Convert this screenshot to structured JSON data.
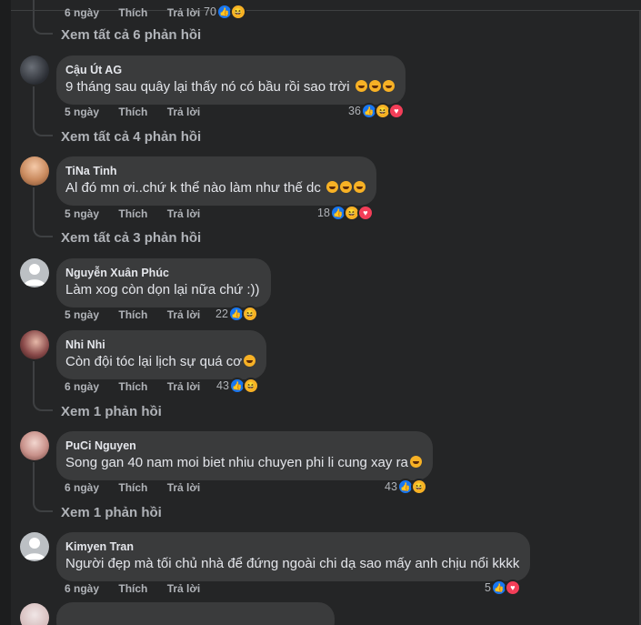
{
  "top_partial": {
    "time": "6 ngày",
    "like": "Thích",
    "reply": "Trả lời",
    "count": "70"
  },
  "view_all_1": "Xem tất cả 6 phản hồi",
  "comments": [
    {
      "author": "Cậu Út AG",
      "text": "9 tháng sau quây lại thấy nó có bầu rồi sao trời",
      "emojis": "rofl-icon x3",
      "time": "5 ngày",
      "like": "Thích",
      "reply": "Trả lời",
      "count": "36",
      "more": "Xem tất cả 4 phản hồi"
    },
    {
      "author": "TiNa Tinh",
      "text": "Al đó mn ơi..chứ k thể nào làm như thế dc",
      "emojis": "rofl-icon x3",
      "time": "5 ngày",
      "like": "Thích",
      "reply": "Trả lời",
      "count": "18",
      "more": "Xem tất cả 3 phản hồi"
    },
    {
      "author": "Nguyễn Xuân Phúc",
      "text": "Làm xog còn dọn lại nữa chứ :))",
      "time": "5 ngày",
      "like": "Thích",
      "reply": "Trả lời",
      "count": "22"
    },
    {
      "author": "Nhi Nhi",
      "text": "Còn đội tóc lại lịch sự quá cơ",
      "emojis": "relieved-icon",
      "time": "6 ngày",
      "like": "Thích",
      "reply": "Trả lời",
      "count": "43",
      "more": "Xem 1 phản hồi"
    },
    {
      "author": "PuCi Nguyen",
      "text": "Song gan 40 nam moi biet nhiu chuyen phi li cung xay ra",
      "emojis": "thinking-icon",
      "time": "6 ngày",
      "like": "Thích",
      "reply": "Trả lời",
      "count": "43",
      "more": "Xem 1 phản hồi"
    },
    {
      "author": "Kimyen Tran",
      "text": "Người đẹp mà tối chủ nhà để đứng ngoài chi dạ sao mấy anh chịu nổi kkkk",
      "time": "6 ngày",
      "like": "Thích",
      "reply": "Trả lời",
      "count": "5"
    }
  ],
  "colors": {
    "background": "#242526",
    "bubble": "#3a3b3c",
    "like": "#1877f2",
    "love": "#f33e58",
    "haha": "#f7b125"
  }
}
